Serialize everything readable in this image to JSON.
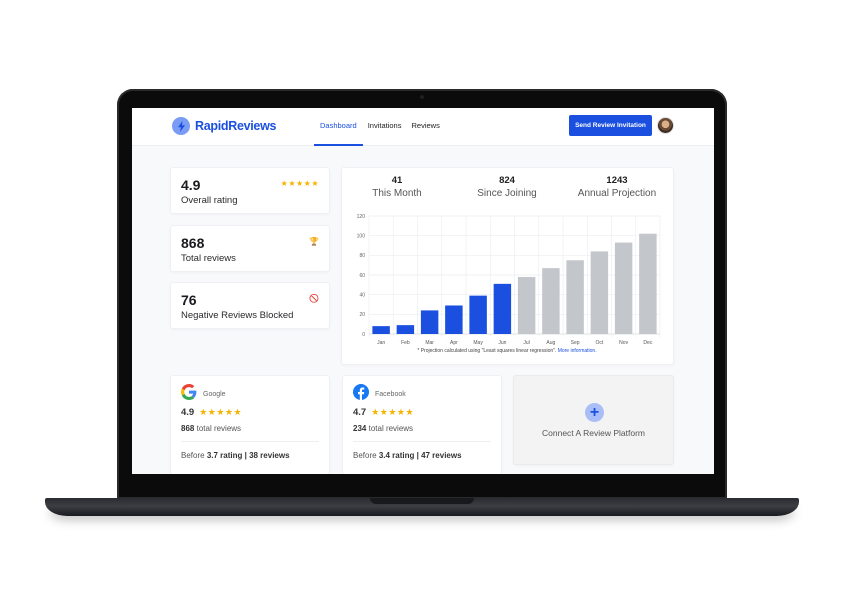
{
  "app": {
    "brand": "RapidReviews",
    "brand_color": "#1a4fe0"
  },
  "header": {
    "nav": [
      {
        "label": "Dashboard",
        "active": true
      },
      {
        "label": "Invitations",
        "active": false
      },
      {
        "label": "Reviews",
        "active": false
      }
    ],
    "cta_label": "Send Review Invitation",
    "avatar_icon": "user-avatar"
  },
  "stats": [
    {
      "value": "4.9",
      "label": "Overall rating",
      "icon": "five-stars",
      "icon_text": "★★★★★"
    },
    {
      "value": "868",
      "label": "Total reviews",
      "icon": "trophy-icon",
      "icon_text": "🏆"
    },
    {
      "value": "76",
      "label": "Negative Reviews Blocked",
      "icon": "blocked-icon",
      "icon_text": "🚫"
    }
  ],
  "summary": [
    {
      "value": "41",
      "label": "This Month"
    },
    {
      "value": "824",
      "label": "Since Joining"
    },
    {
      "value": "1243",
      "label": "Annual Projection"
    }
  ],
  "chart_data": {
    "type": "bar",
    "title": "",
    "xlabel": "",
    "ylabel": "",
    "categories": [
      "Jan",
      "Feb",
      "Mar",
      "Apr",
      "May",
      "Jun",
      "Jul",
      "Aug",
      "Sep",
      "Oct",
      "Nov",
      "Dec"
    ],
    "series": [
      {
        "name": "Actual",
        "color": "#1a4fe0",
        "values": [
          8,
          9,
          24,
          29,
          39,
          51,
          null,
          null,
          null,
          null,
          null,
          null
        ]
      },
      {
        "name": "Projection",
        "color": "#c3c7cc",
        "values": [
          null,
          null,
          null,
          null,
          null,
          null,
          58,
          67,
          75,
          84,
          93,
          102
        ]
      }
    ],
    "ylim": [
      0,
      120
    ],
    "yticks": [
      0,
      20,
      40,
      60,
      80,
      100,
      120
    ],
    "grid": true,
    "legend": "none"
  },
  "footnote": {
    "text": "* Projection calculated using \"Least squares linear regression\".",
    "link": "More information."
  },
  "platforms": [
    {
      "name": "Google",
      "icon": "google-icon",
      "rating": "4.9",
      "stars": "★★★★★",
      "total_num": "868",
      "total_text": "total reviews",
      "before_prefix": "Before",
      "before_value": "3.7 rating | 38 reviews"
    },
    {
      "name": "Facebook",
      "icon": "facebook-icon",
      "rating": "4.7",
      "stars": "★★★★★",
      "total_num": "234",
      "total_text": "total reviews",
      "before_prefix": "Before",
      "before_value": "3.4 rating | 47 reviews"
    }
  ],
  "connect": {
    "label": "Connect A Review Platform",
    "icon_text": "+"
  }
}
